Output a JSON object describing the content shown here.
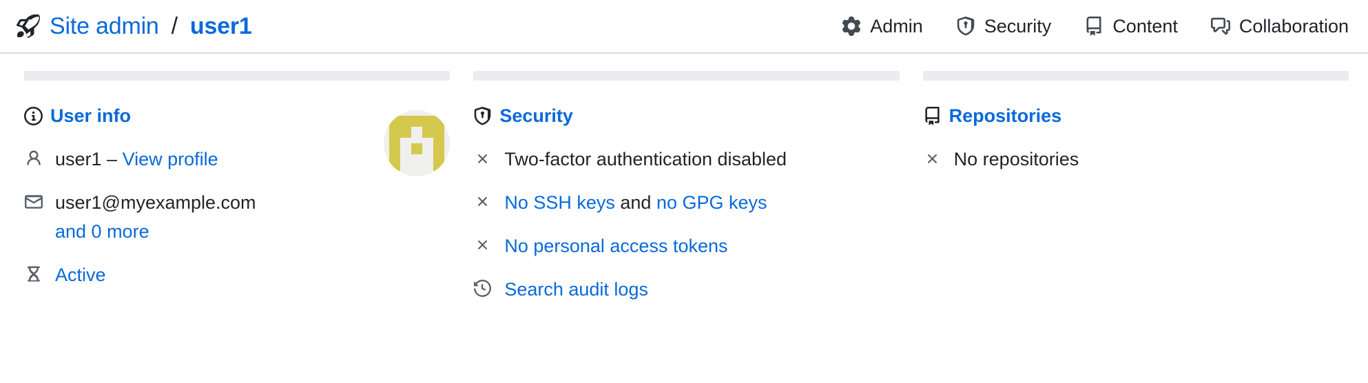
{
  "header": {
    "rocket_icon": "rocket-icon",
    "breadcrumb": {
      "root_label": "Site admin",
      "separator": "/",
      "current_label": "user1"
    },
    "nav": [
      {
        "icon": "gear-icon",
        "label": "Admin"
      },
      {
        "icon": "shield-lock-icon",
        "label": "Security"
      },
      {
        "icon": "book-icon",
        "label": "Content"
      },
      {
        "icon": "comment-discussion-icon",
        "label": "Collaboration"
      }
    ]
  },
  "columns": [
    {
      "id": "user-info",
      "title": "User info",
      "title_icon": "info-icon",
      "avatar": {
        "name": "user-avatar-identicon",
        "background": "#f0f0ee",
        "color": "#d5c84e"
      },
      "rows": [
        {
          "icon": "person-icon",
          "icon_color": "#57606a",
          "text": "user1",
          "dash": " – ",
          "link": "View profile"
        },
        {
          "icon": "mail-icon",
          "icon_color": "#57606a",
          "text": "user1@myexample.com",
          "sub_link": "and 0 more"
        },
        {
          "icon": "hourglass-icon",
          "icon_color": "#1a7f37",
          "link": "Active"
        }
      ]
    },
    {
      "id": "security",
      "title": "Security",
      "title_icon": "shield-lock-icon",
      "rows": [
        {
          "icon": "x-icon",
          "icon_color": "#57606a",
          "text": "Two-factor authentication disabled"
        },
        {
          "icon": "x-icon",
          "icon_color": "#57606a",
          "link": "No SSH keys",
          "mid": " and ",
          "link2": "no GPG keys"
        },
        {
          "icon": "x-icon",
          "icon_color": "#57606a",
          "link": "No personal access tokens"
        },
        {
          "icon": "history-icon",
          "icon_color": "#57606a",
          "link": "Search audit logs"
        }
      ]
    },
    {
      "id": "repositories",
      "title": "Repositories",
      "title_icon": "repo-icon",
      "rows": [
        {
          "icon": "x-icon",
          "icon_color": "#57606a",
          "text": "No repositories"
        }
      ]
    }
  ],
  "colors": {
    "link": "#0969da",
    "text": "#1f2328",
    "muted": "#57606a",
    "rule": "#eaecef",
    "border": "#d8dee4",
    "green": "#1a7f37"
  }
}
